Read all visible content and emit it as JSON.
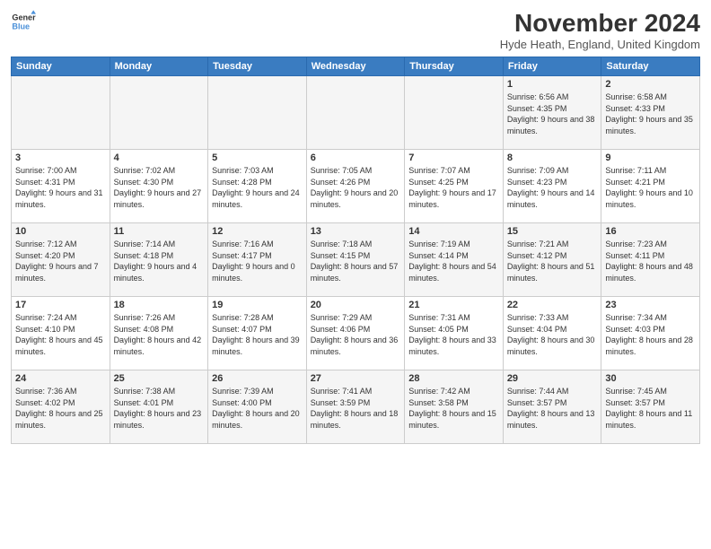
{
  "header": {
    "logo_line1": "General",
    "logo_line2": "Blue",
    "month_title": "November 2024",
    "location": "Hyde Heath, England, United Kingdom"
  },
  "weekdays": [
    "Sunday",
    "Monday",
    "Tuesday",
    "Wednesday",
    "Thursday",
    "Friday",
    "Saturday"
  ],
  "weeks": [
    [
      {
        "day": "",
        "info": ""
      },
      {
        "day": "",
        "info": ""
      },
      {
        "day": "",
        "info": ""
      },
      {
        "day": "",
        "info": ""
      },
      {
        "day": "",
        "info": ""
      },
      {
        "day": "1",
        "info": "Sunrise: 6:56 AM\nSunset: 4:35 PM\nDaylight: 9 hours and 38 minutes."
      },
      {
        "day": "2",
        "info": "Sunrise: 6:58 AM\nSunset: 4:33 PM\nDaylight: 9 hours and 35 minutes."
      }
    ],
    [
      {
        "day": "3",
        "info": "Sunrise: 7:00 AM\nSunset: 4:31 PM\nDaylight: 9 hours and 31 minutes."
      },
      {
        "day": "4",
        "info": "Sunrise: 7:02 AM\nSunset: 4:30 PM\nDaylight: 9 hours and 27 minutes."
      },
      {
        "day": "5",
        "info": "Sunrise: 7:03 AM\nSunset: 4:28 PM\nDaylight: 9 hours and 24 minutes."
      },
      {
        "day": "6",
        "info": "Sunrise: 7:05 AM\nSunset: 4:26 PM\nDaylight: 9 hours and 20 minutes."
      },
      {
        "day": "7",
        "info": "Sunrise: 7:07 AM\nSunset: 4:25 PM\nDaylight: 9 hours and 17 minutes."
      },
      {
        "day": "8",
        "info": "Sunrise: 7:09 AM\nSunset: 4:23 PM\nDaylight: 9 hours and 14 minutes."
      },
      {
        "day": "9",
        "info": "Sunrise: 7:11 AM\nSunset: 4:21 PM\nDaylight: 9 hours and 10 minutes."
      }
    ],
    [
      {
        "day": "10",
        "info": "Sunrise: 7:12 AM\nSunset: 4:20 PM\nDaylight: 9 hours and 7 minutes."
      },
      {
        "day": "11",
        "info": "Sunrise: 7:14 AM\nSunset: 4:18 PM\nDaylight: 9 hours and 4 minutes."
      },
      {
        "day": "12",
        "info": "Sunrise: 7:16 AM\nSunset: 4:17 PM\nDaylight: 9 hours and 0 minutes."
      },
      {
        "day": "13",
        "info": "Sunrise: 7:18 AM\nSunset: 4:15 PM\nDaylight: 8 hours and 57 minutes."
      },
      {
        "day": "14",
        "info": "Sunrise: 7:19 AM\nSunset: 4:14 PM\nDaylight: 8 hours and 54 minutes."
      },
      {
        "day": "15",
        "info": "Sunrise: 7:21 AM\nSunset: 4:12 PM\nDaylight: 8 hours and 51 minutes."
      },
      {
        "day": "16",
        "info": "Sunrise: 7:23 AM\nSunset: 4:11 PM\nDaylight: 8 hours and 48 minutes."
      }
    ],
    [
      {
        "day": "17",
        "info": "Sunrise: 7:24 AM\nSunset: 4:10 PM\nDaylight: 8 hours and 45 minutes."
      },
      {
        "day": "18",
        "info": "Sunrise: 7:26 AM\nSunset: 4:08 PM\nDaylight: 8 hours and 42 minutes."
      },
      {
        "day": "19",
        "info": "Sunrise: 7:28 AM\nSunset: 4:07 PM\nDaylight: 8 hours and 39 minutes."
      },
      {
        "day": "20",
        "info": "Sunrise: 7:29 AM\nSunset: 4:06 PM\nDaylight: 8 hours and 36 minutes."
      },
      {
        "day": "21",
        "info": "Sunrise: 7:31 AM\nSunset: 4:05 PM\nDaylight: 8 hours and 33 minutes."
      },
      {
        "day": "22",
        "info": "Sunrise: 7:33 AM\nSunset: 4:04 PM\nDaylight: 8 hours and 30 minutes."
      },
      {
        "day": "23",
        "info": "Sunrise: 7:34 AM\nSunset: 4:03 PM\nDaylight: 8 hours and 28 minutes."
      }
    ],
    [
      {
        "day": "24",
        "info": "Sunrise: 7:36 AM\nSunset: 4:02 PM\nDaylight: 8 hours and 25 minutes."
      },
      {
        "day": "25",
        "info": "Sunrise: 7:38 AM\nSunset: 4:01 PM\nDaylight: 8 hours and 23 minutes."
      },
      {
        "day": "26",
        "info": "Sunrise: 7:39 AM\nSunset: 4:00 PM\nDaylight: 8 hours and 20 minutes."
      },
      {
        "day": "27",
        "info": "Sunrise: 7:41 AM\nSunset: 3:59 PM\nDaylight: 8 hours and 18 minutes."
      },
      {
        "day": "28",
        "info": "Sunrise: 7:42 AM\nSunset: 3:58 PM\nDaylight: 8 hours and 15 minutes."
      },
      {
        "day": "29",
        "info": "Sunrise: 7:44 AM\nSunset: 3:57 PM\nDaylight: 8 hours and 13 minutes."
      },
      {
        "day": "30",
        "info": "Sunrise: 7:45 AM\nSunset: 3:57 PM\nDaylight: 8 hours and 11 minutes."
      }
    ]
  ]
}
